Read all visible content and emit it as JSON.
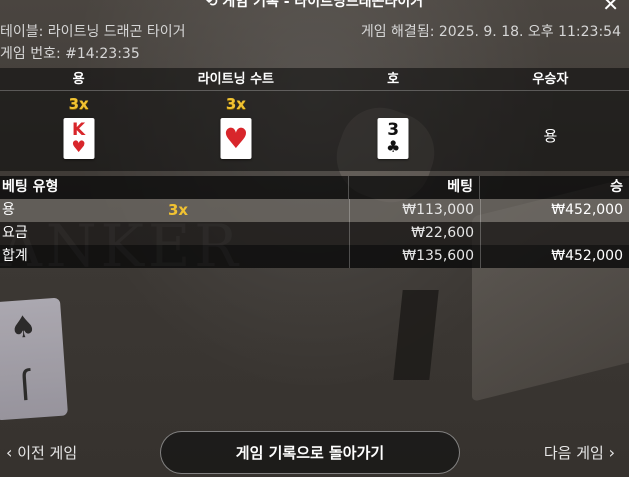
{
  "header": {
    "title": "기록 - 라이트닝드래곤타이거",
    "history_icon": "history-icon",
    "close_icon": "close-icon",
    "table_line": "테이블: 라이트닝 드래곤 타이거",
    "resolved_line": "게임 해결됨: 2025. 9. 18. 오후 11:23:54",
    "round_line": "게임 번호: #14:23:35"
  },
  "result": {
    "columns": [
      "용",
      "라이트닝 수트",
      "호",
      "우승자"
    ],
    "dragon": {
      "multiplier": "3x",
      "rank": "K",
      "suit": "♥",
      "color": "#d8262b"
    },
    "lightning_suit": {
      "multiplier": "3x",
      "suit": "♥",
      "color": "#d8262b"
    },
    "tiger": {
      "rank": "3",
      "suit": "♣",
      "color": "#111111"
    },
    "winner": "용"
  },
  "bets": {
    "headers": [
      "베팅 유형",
      "베팅",
      "승"
    ],
    "rows": [
      {
        "label": "용",
        "multiplier": "3x",
        "bet": "₩113,000",
        "win": "₩452,000"
      },
      {
        "label": "요금",
        "multiplier": "",
        "bet": "₩22,600",
        "win": ""
      },
      {
        "label": "합계",
        "multiplier": "",
        "bet": "₩135,600",
        "win": "₩452,000"
      }
    ]
  },
  "background": {
    "watermark": "ANKER"
  },
  "footer": {
    "prev_label": "이전 게임",
    "back_label": "게임 기록으로 돌아가기",
    "next_label": "다음 게임"
  },
  "colors": {
    "accent_gold": "#f1c232",
    "card_red": "#d8262b"
  }
}
